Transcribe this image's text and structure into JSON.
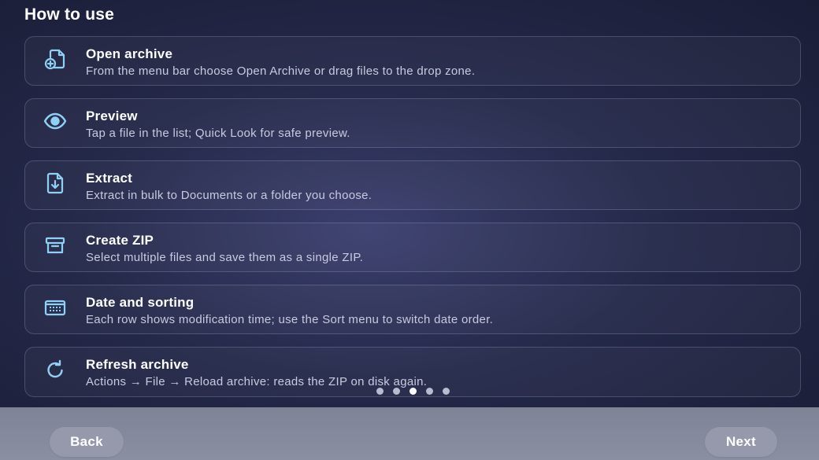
{
  "header": {
    "title": "How to use"
  },
  "steps": [
    {
      "icon": "add-document-icon",
      "title": "Open archive",
      "description": "From the menu bar choose Open Archive or drag files to the drop zone."
    },
    {
      "icon": "eye-icon",
      "title": "Preview",
      "description": "Tap a file in the list; Quick Look for safe preview."
    },
    {
      "icon": "download-document-icon",
      "title": "Extract",
      "description": "Extract in bulk to Documents or a folder you choose."
    },
    {
      "icon": "archive-box-icon",
      "title": "Create ZIP",
      "description": "Select multiple files and save them as a single ZIP."
    },
    {
      "icon": "calendar-icon",
      "title": "Date and sorting",
      "description": "Each row shows modification time; use the Sort menu to switch date order."
    },
    {
      "icon": "refresh-icon",
      "title": "Refresh archive",
      "description": "Actions → File → Reload archive: reads the ZIP on disk again."
    }
  ],
  "pagination": {
    "total": 5,
    "current": 3
  },
  "footer": {
    "back_label": "Back",
    "next_label": "Next"
  },
  "colors": {
    "accent_icon": "#8fd0f5",
    "background": "#25294a",
    "footer": "#8a8fa2"
  }
}
